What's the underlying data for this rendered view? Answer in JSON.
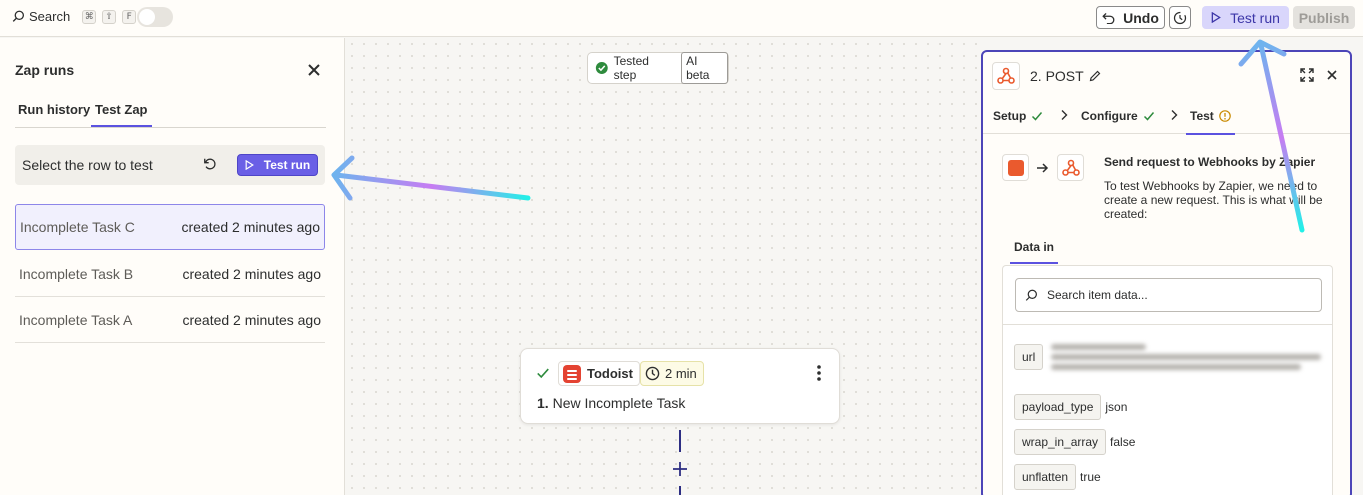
{
  "topbar": {
    "search_label": "Search",
    "shortcut_keys": [
      "⌘",
      "⇧",
      "F"
    ],
    "undo_label": "Undo",
    "test_run_label": "Test run",
    "publish_label": "Publish"
  },
  "left_panel": {
    "title": "Zap runs",
    "tabs": [
      {
        "label": "Run history",
        "active": false
      },
      {
        "label": "Test Zap",
        "active": true
      }
    ],
    "select_label": "Select the row to test",
    "test_run_label": "Test run",
    "rows": [
      {
        "name": "Incomplete Task C",
        "time": "created 2 minutes ago",
        "selected": true
      },
      {
        "name": "Incomplete Task B",
        "time": "created 2 minutes ago",
        "selected": false
      },
      {
        "name": "Incomplete Task A",
        "time": "created 2 minutes ago",
        "selected": false
      }
    ]
  },
  "canvas": {
    "chip_label": "Tested step",
    "chip_badge": "AI beta",
    "step": {
      "app_name": "Todoist",
      "time": "2 min",
      "number": "1.",
      "title": "New Incomplete Task"
    }
  },
  "right_panel": {
    "title": "2. POST",
    "steps": [
      {
        "label": "Setup",
        "status": "done"
      },
      {
        "label": "Configure",
        "status": "done"
      },
      {
        "label": "Test",
        "status": "warning"
      }
    ],
    "info_title": "Send request to Webhooks by Zapier",
    "info_text": "To test Webhooks by Zapier, we need to create a new request. This is what will be created:",
    "data_tab": "Data in",
    "search_placeholder": "Search item data...",
    "fields": [
      {
        "key": "url",
        "value": ""
      },
      {
        "key": "payload_type",
        "value": "json"
      },
      {
        "key": "wrap_in_array",
        "value": "false"
      },
      {
        "key": "unflatten",
        "value": "true"
      }
    ]
  },
  "colors": {
    "accent": "#5b52e0",
    "test_run_bg": "#6a5fe6",
    "todoist": "#e44332",
    "webhook": "#ea5a2e",
    "success": "#2e8b3d",
    "warning": "#c98a00"
  }
}
